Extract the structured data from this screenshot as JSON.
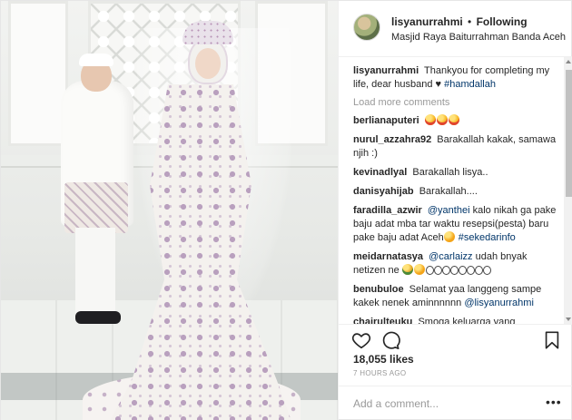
{
  "post": {
    "username": "lisyanurrahmi",
    "separator": "•",
    "follow_status": "Following",
    "location": "Masjid Raya Baiturrahman Banda Aceh"
  },
  "caption": {
    "username": "lisyanurrahmi",
    "text": "Thankyou for completing my life, dear husband ♥",
    "hashtag": "#hamdallah"
  },
  "load_more": "Load more comments",
  "comments": [
    {
      "user": "berlianaputeri",
      "text": "",
      "emoji": [
        "heart-eyes",
        "heart-eyes",
        "heart-eyes"
      ]
    },
    {
      "user": "nurul_azzahra92",
      "text": "Barakallah kakak, samawa njih :)"
    },
    {
      "user": "kevinadlyal",
      "text": "Barakallah lisya.."
    },
    {
      "user": "danisyahijab",
      "text": "Barakallah...."
    },
    {
      "user": "faradilla_azwir",
      "mention": "@yanthei",
      "text": "kalo nikah ga pake baju adat mba tar waktu resepsi(pesta) baru pake baju adat Aceh",
      "hashtag": "#sekedarinfo"
    },
    {
      "user": "meidarnatasya",
      "mention": "@carlaizz",
      "text": "udah bnyak netizen ne"
    },
    {
      "user": "benubuloe",
      "text": "Selamat yaa langgeng sampe kakek nenek aminnnnnn",
      "mention": "@lisyanurrahmi"
    },
    {
      "user": "chairulteuku",
      "text": "Smoga keluarga yang"
    }
  ],
  "likes": "18,055 likes",
  "time": "7 HOURS AGO",
  "add_comment_placeholder": "Add a comment...",
  "more_symbol": "•••",
  "colors": {
    "link": "#003569",
    "muted": "#999999",
    "text": "#262626"
  }
}
